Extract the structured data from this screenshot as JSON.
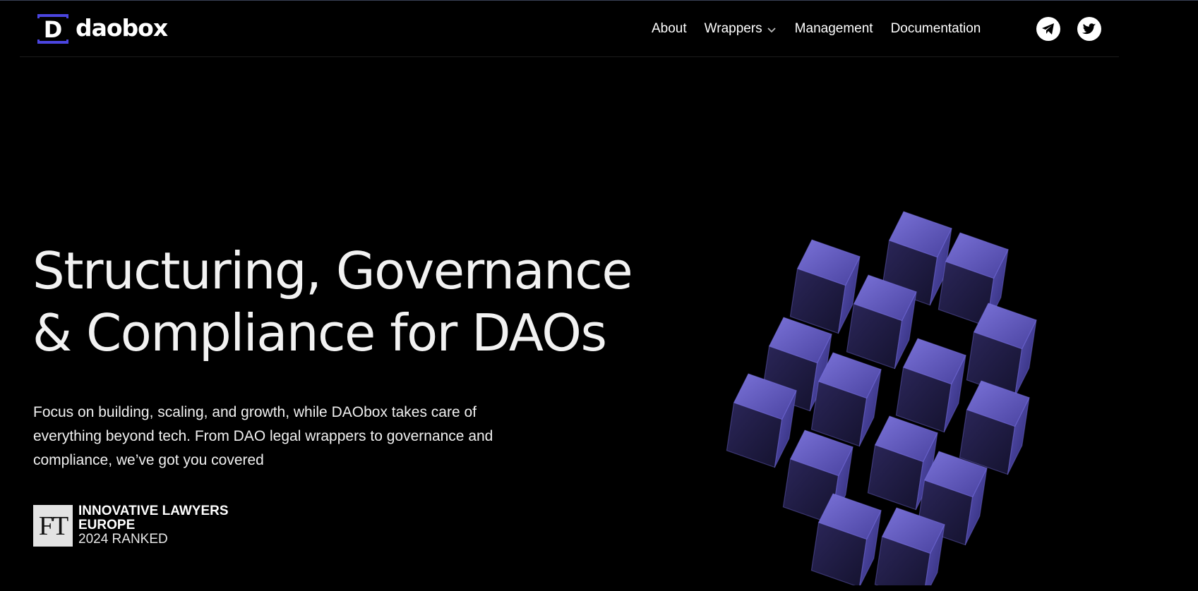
{
  "brand": {
    "name": "daobox",
    "logo_letter": "D",
    "accent_color": "#4b45e0"
  },
  "nav": {
    "about": "About",
    "wrappers": "Wrappers",
    "management": "Management",
    "documentation": "Documentation"
  },
  "social": {
    "telegram_icon": "telegram-icon",
    "twitter_icon": "twitter-icon"
  },
  "hero": {
    "title_line1": "Structuring, Governance",
    "title_line2": "& Compliance for DAOs",
    "desc_line1": "Focus on building, scaling, and growth, while DAObox takes care of",
    "desc_line2": "everything beyond tech. From DAO legal wrappers to governance and",
    "desc_line3": "compliance, we’ve got you covered"
  },
  "badge": {
    "logo_text": "FT",
    "line1": "INNOVATIVE LAWYERS",
    "line2": "EUROPE",
    "line3": "2024 RANKED"
  }
}
